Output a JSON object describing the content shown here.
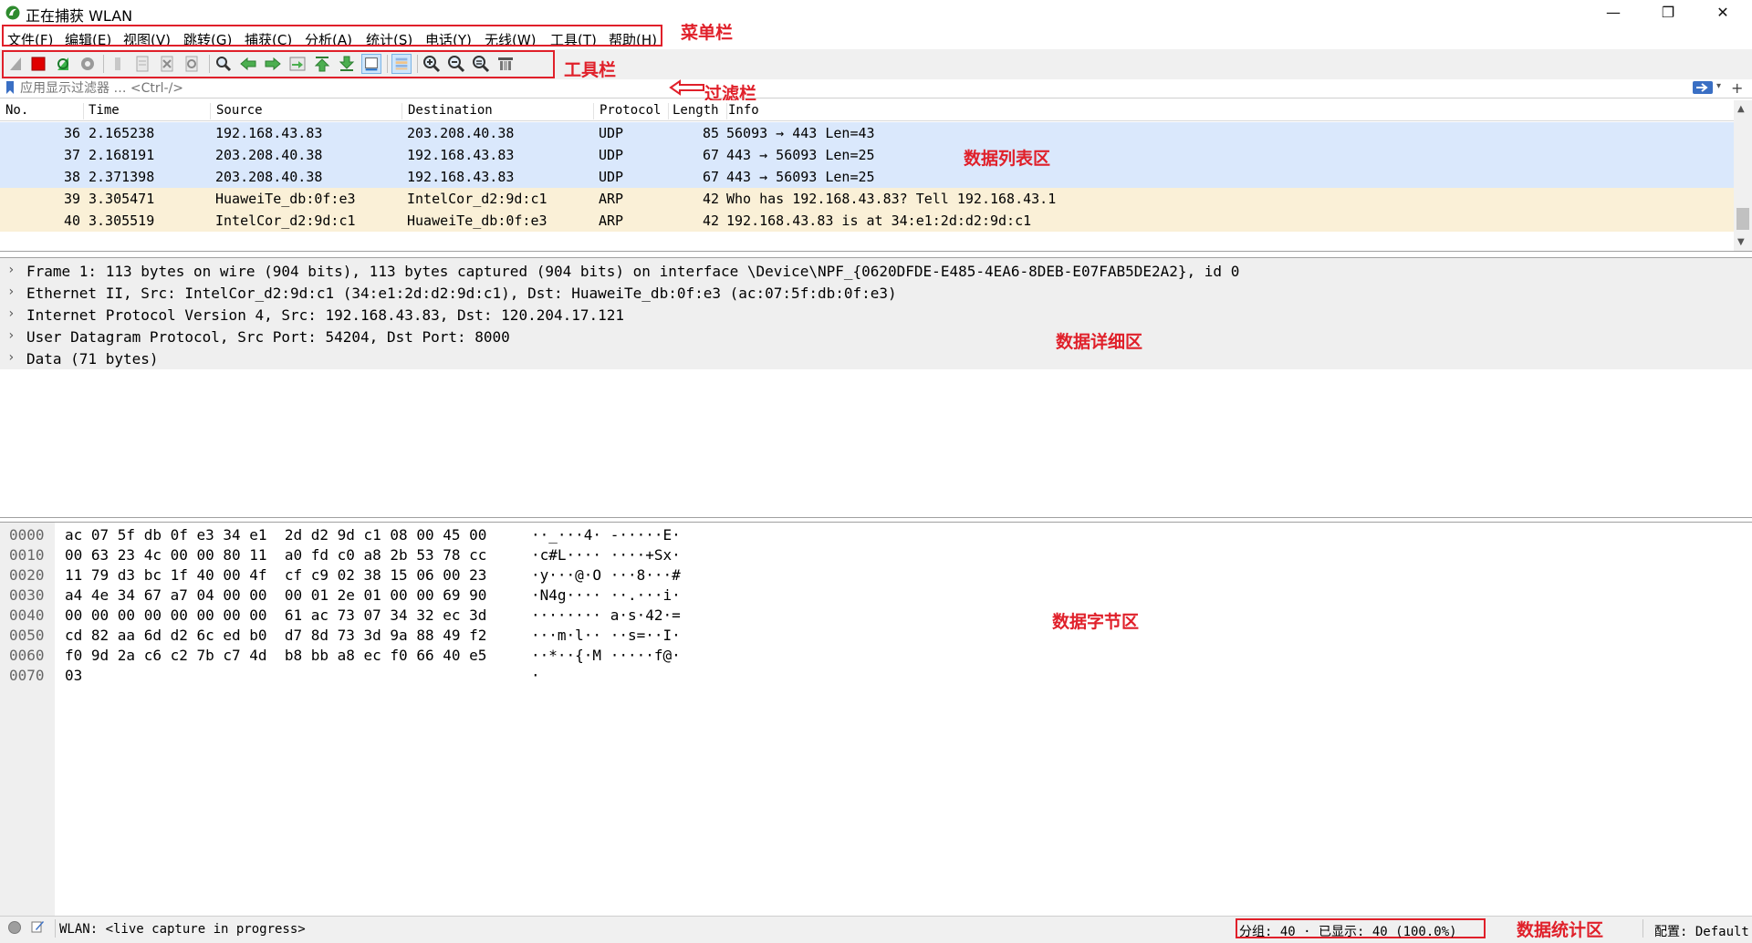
{
  "window": {
    "title": "正在捕获 WLAN",
    "minimize_glyph": "—",
    "maximize_glyph": "❐",
    "close_glyph": "✕",
    "icon": "wireshark-fin-icon"
  },
  "menu": {
    "items": [
      "文件(F)",
      "编辑(E)",
      "视图(V)",
      "跳转(G)",
      "捕获(C)",
      "分析(A)",
      "统计(S)",
      "电话(Y)",
      "无线(W)",
      "工具(T)",
      "帮助(H)"
    ]
  },
  "toolbar": {
    "icons": [
      "start-capture-icon",
      "stop-capture-icon",
      "restart-capture-icon",
      "capture-options-icon",
      "open-file-icon",
      "save-file-icon",
      "close-file-icon",
      "reload-file-icon",
      "find-packet-icon",
      "go-back-icon",
      "go-forward-icon",
      "go-to-packet-icon",
      "go-first-icon",
      "go-last-icon",
      "auto-scroll-icon",
      "colorize-icon",
      "zoom-in-icon",
      "zoom-out-icon",
      "zoom-normal-icon",
      "resize-columns-icon"
    ]
  },
  "filter": {
    "placeholder": "应用显示过滤器 … <Ctrl-/>",
    "dropdown_glyph": "▾",
    "add_glyph": "+"
  },
  "packet_list": {
    "columns": [
      "No.",
      "Time",
      "Source",
      "Destination",
      "Protocol",
      "Length",
      "Info"
    ],
    "rows": [
      {
        "no": "36",
        "time": "2.165238",
        "source": "192.168.43.83",
        "destination": "203.208.40.38",
        "protocol": "UDP",
        "length": "85",
        "info": "56093 → 443 Len=43"
      },
      {
        "no": "37",
        "time": "2.168191",
        "source": "203.208.40.38",
        "destination": "192.168.43.83",
        "protocol": "UDP",
        "length": "67",
        "info": "443 → 56093 Len=25"
      },
      {
        "no": "38",
        "time": "2.371398",
        "source": "203.208.40.38",
        "destination": "192.168.43.83",
        "protocol": "UDP",
        "length": "67",
        "info": "443 → 56093 Len=25"
      },
      {
        "no": "39",
        "time": "3.305471",
        "source": "HuaweiTe_db:0f:e3",
        "destination": "IntelCor_d2:9d:c1",
        "protocol": "ARP",
        "length": "42",
        "info": "Who has 192.168.43.83? Tell 192.168.43.1"
      },
      {
        "no": "40",
        "time": "3.305519",
        "source": "IntelCor_d2:9d:c1",
        "destination": "HuaweiTe_db:0f:e3",
        "protocol": "ARP",
        "length": "42",
        "info": "192.168.43.83 is at 34:e1:2d:d2:9d:c1"
      }
    ],
    "scroll_up_glyph": "▲",
    "scroll_down_glyph": "▼"
  },
  "details": {
    "arrow_glyph": "›",
    "rows": [
      "Frame 1: 113 bytes on wire (904 bits), 113 bytes captured (904 bits) on interface \\Device\\NPF_{0620DFDE-E485-4EA6-8DEB-E07FAB5DE2A2}, id 0",
      "Ethernet II, Src: IntelCor_d2:9d:c1 (34:e1:2d:d2:9d:c1), Dst: HuaweiTe_db:0f:e3 (ac:07:5f:db:0f:e3)",
      "Internet Protocol Version 4, Src: 192.168.43.83, Dst: 120.204.17.121",
      "User Datagram Protocol, Src Port: 54204, Dst Port: 8000",
      "Data (71 bytes)"
    ]
  },
  "bytes": {
    "rows": [
      {
        "offset": "0000",
        "hex": "ac 07 5f db 0f e3 34 e1  2d d2 9d c1 08 00 45 00",
        "ascii": "··_···4· -·····E·"
      },
      {
        "offset": "0010",
        "hex": "00 63 23 4c 00 00 80 11  a0 fd c0 a8 2b 53 78 cc",
        "ascii": "·c#L···· ····+Sx·"
      },
      {
        "offset": "0020",
        "hex": "11 79 d3 bc 1f 40 00 4f  cf c9 02 38 15 06 00 23",
        "ascii": "·y···@·O ···8···#"
      },
      {
        "offset": "0030",
        "hex": "a4 4e 34 67 a7 04 00 00  00 01 2e 01 00 00 69 90",
        "ascii": "·N4g···· ··.···i·"
      },
      {
        "offset": "0040",
        "hex": "00 00 00 00 00 00 00 00  61 ac 73 07 34 32 ec 3d",
        "ascii": "········ a·s·42·="
      },
      {
        "offset": "0050",
        "hex": "cd 82 aa 6d d2 6c ed b0  d7 8d 73 3d 9a 88 49 f2",
        "ascii": "···m·l·· ··s=··I·"
      },
      {
        "offset": "0060",
        "hex": "f0 9d 2a c6 c2 7b c7 4d  b8 bb a8 ec f0 66 40 e5",
        "ascii": "··*··{·M ·····f@·"
      },
      {
        "offset": "0070",
        "hex": "03",
        "ascii": "·"
      }
    ]
  },
  "annotations": {
    "menubar": "菜单栏",
    "toolbar": "工具栏",
    "filterbar": "过滤栏",
    "packet_list": "数据列表区",
    "details": "数据详细区",
    "bytes": "数据字节区",
    "stats": "数据统计区"
  },
  "status": {
    "text": "WLAN: <live capture in progress>",
    "stats": "分组: 40 · 已显示: 40 (100.0%)",
    "profile": "配置: Default"
  },
  "colors": {
    "udp_row": "#dae8fc",
    "arp_row": "#faf0d7",
    "annotation": "#e0202a"
  }
}
